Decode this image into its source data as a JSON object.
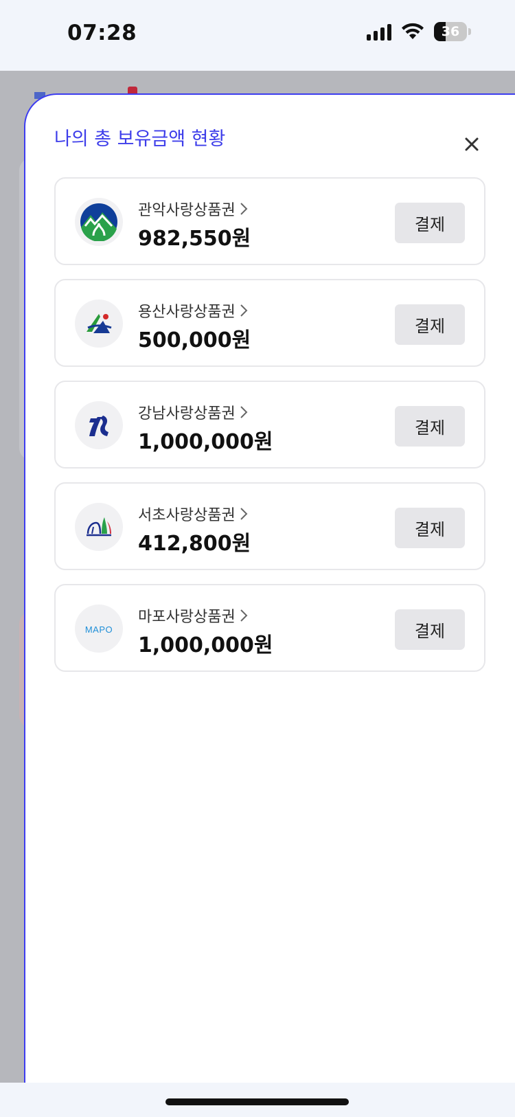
{
  "status_bar": {
    "time": "07:28",
    "battery": "36",
    "battery_level": 0.36,
    "signal_icon": "cellular-signal-icon",
    "wifi_icon": "wifi-icon"
  },
  "modal": {
    "title": "나의 총 보유금액 현황",
    "close_icon": "close-icon"
  },
  "vouchers": [
    {
      "name": "관악사랑상품권",
      "amount": "982,550원",
      "button": "결제",
      "logo_icon": "gwanak-logo-icon"
    },
    {
      "name": "용산사랑상품권",
      "amount": "500,000원",
      "button": "결제",
      "logo_icon": "yongsan-logo-icon"
    },
    {
      "name": "강남사랑상품권",
      "amount": "1,000,000원",
      "button": "결제",
      "logo_icon": "gangnam-logo-icon"
    },
    {
      "name": "서초사랑상품권",
      "amount": "412,800원",
      "button": "결제",
      "logo_icon": "seocho-logo-icon"
    },
    {
      "name": "마포사랑상품권",
      "amount": "1,000,000원",
      "button": "결제",
      "logo_icon": "mapo-logo-icon",
      "logo_text": "MAPO"
    }
  ],
  "colors": {
    "accent": "#3d3dea",
    "status_bar_bg": "#f2f5fb",
    "backdrop": "#b6b7bc",
    "button_bg": "#e6e6e9"
  }
}
